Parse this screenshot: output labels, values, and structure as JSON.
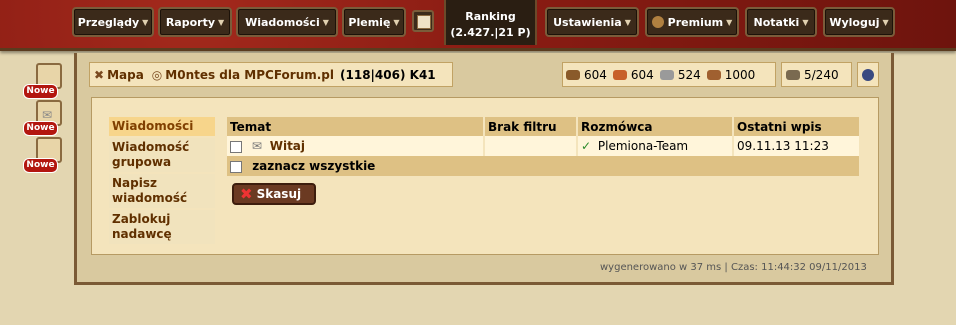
{
  "nav": {
    "przeglady": "Przeglądy",
    "raporty": "Raporty",
    "wiadomosci": "Wiadomości",
    "plemie": "Plemię",
    "ranking_label": "Ranking",
    "ranking_value": "(2.427.|21 P)",
    "ustawienia": "Ustawienia",
    "premium": "Premium",
    "notatki": "Notatki",
    "wyloguj": "Wyloguj"
  },
  "village": {
    "map_label": "Mapa",
    "name": "M0ntes dla MPCForum.pl",
    "coords": "(118|406) K41"
  },
  "resources": {
    "wood": "604",
    "clay": "604",
    "iron": "524",
    "storage": "1000",
    "population": "5/240"
  },
  "sidebar": {
    "badge": "Nowe"
  },
  "menu": [
    "Wiadomości",
    "Wiadomość grupowa",
    "Napisz wiadomość",
    "Zablokuj nadawcę"
  ],
  "table": {
    "headers": [
      "Temat",
      "Brak filtru",
      "Rozmówca",
      "Ostatni wpis"
    ],
    "row": {
      "subject": "Witaj",
      "partner": "Plemiona-Team",
      "date": "09.11.13 11:23"
    },
    "select_all": "zaznacz wszystkie"
  },
  "delete_button": "Skasuj",
  "footer": "wygenerowano w 37 ms | Czas: 11:44:32 09/11/2013"
}
